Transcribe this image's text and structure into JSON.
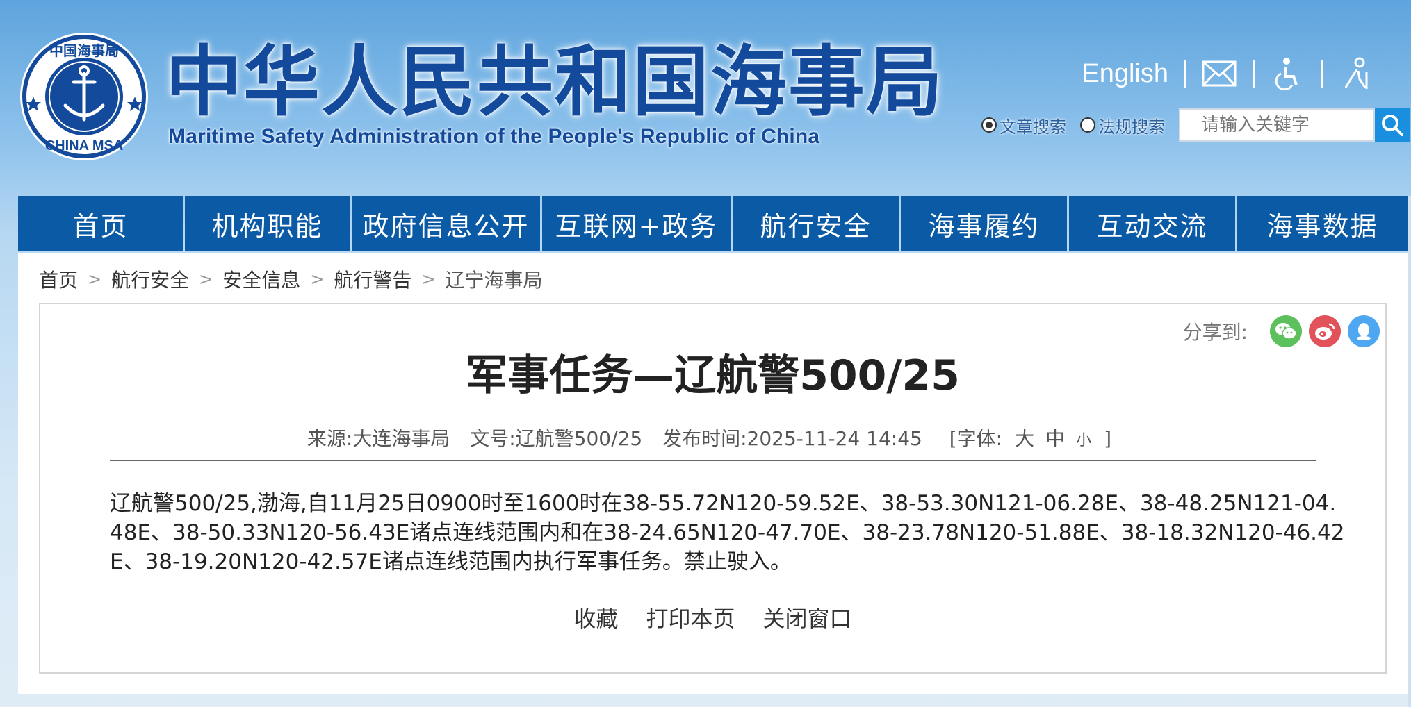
{
  "header": {
    "title_cn": "中华人民共和国海事局",
    "title_en": "Maritime Safety Administration of the People's Republic of China",
    "emblem": {
      "icon": "msa-emblem-icon",
      "top_text": "中国海事局",
      "bottom_text": "CHINA MSA"
    },
    "links": {
      "english": "English",
      "mail_icon": "mail-icon",
      "accessibility_icon": "accessibility-icon",
      "elderly_icon": "elderly-care-icon"
    },
    "search": {
      "radio_article": "文章搜索",
      "radio_regulation": "法规搜索",
      "selected": "文章搜索",
      "placeholder": "请输入关键字",
      "button_icon": "search-icon"
    }
  },
  "nav": {
    "items": [
      {
        "label": "首页"
      },
      {
        "label": "机构职能"
      },
      {
        "label": "政府信息公开"
      },
      {
        "label": "互联网+政务"
      },
      {
        "label": "航行安全"
      },
      {
        "label": "海事履约"
      },
      {
        "label": "互动交流"
      },
      {
        "label": "海事数据"
      }
    ]
  },
  "breadcrumb": {
    "items": [
      "首页",
      "航行安全",
      "安全信息",
      "航行警告",
      "辽宁海事局"
    ],
    "separator": ">"
  },
  "share": {
    "label": "分享到:",
    "icons": [
      "wechat-icon",
      "weibo-icon",
      "qq-icon"
    ]
  },
  "article": {
    "title": "军事任务—辽航警500/25",
    "source_label": "来源:大连海事局",
    "doc_no_label": "文号:辽航警500/25",
    "publish_label": "发布时间:2025-11-24 14:45",
    "font_size_open": "[字体:",
    "font_large": "大",
    "font_medium": "中",
    "font_small": "小",
    "font_size_close": "]",
    "body": "辽航警500/25,渤海,自11月25日0900时至1600时在38-55.72N120-59.52E、38-53.30N121-06.28E、38-48.25N121-04.48E、38-50.33N120-56.43E诸点连线范围内和在38-24.65N120-47.70E、38-23.78N120-51.88E、38-18.32N120-46.42E、38-19.20N120-42.57E诸点连线范围内执行军事任务。禁止驶入。",
    "actions": {
      "favorite": "收藏",
      "print": "打印本页",
      "close": "关闭窗口"
    }
  },
  "colors": {
    "nav_bg": "#0a5aa6",
    "title_blue": "#134a9b",
    "search_btn": "#1a8fdf",
    "wechat": "#5cc15c",
    "weibo": "#e2525a",
    "qq": "#4ea7f0"
  }
}
